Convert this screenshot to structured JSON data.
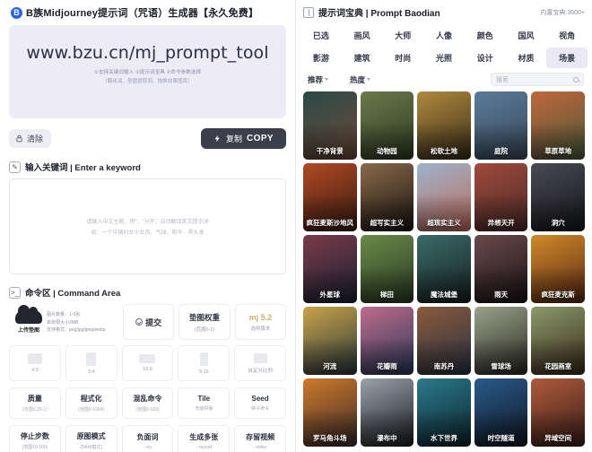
{
  "left": {
    "header": {
      "logo_letter": "B",
      "title": "B族Midjourney提示词（咒语）生成器【永久免费】"
    },
    "url_card": {
      "url": "www.bzu.cn/mj_prompt_tool",
      "sub_line_1": "①支持关键词输入 ②提示词宝典 ③命令参数选择",
      "sub_line_2": "（翻译词、垫图提取同、拖换效果图库）"
    },
    "actions": {
      "clear_label": "清除",
      "clear_icon": "lock-icon",
      "copy_cn": "复制",
      "copy_en": "COPY",
      "copy_icon": "lightning-icon"
    },
    "keyword_section": {
      "icon": "edit-note-icon",
      "label": "输入关键词 | Enter a keyword",
      "placeholder_line_1": "请输入中文主题，用\"，\"分开，自动翻译英文提示词",
      "placeholder_line_2": "如：一个中国妇女小女孩、气球、阳伞、黑头发"
    },
    "command_section": {
      "icon": "terminal-icon",
      "label": "命令区 | Command Area"
    },
    "upload": {
      "label": "上传垫图",
      "icon": "cloud-upload-icon",
      "meta": [
        "图片数量：1-5张",
        "单张限大小2MB",
        "支持格式：png/jpg/jpeg/webp"
      ]
    },
    "submit": {
      "label": "提交",
      "icon": "check-circle-icon"
    },
    "ref_weight": {
      "title": "垫图权重",
      "sub": "(范围0-2)"
    },
    "version": {
      "title": "mj 5.2",
      "sub": "选用版本"
    },
    "aspect_ratios": [
      {
        "label": "4:3",
        "w": 16,
        "h": 12
      },
      {
        "label": "3:4",
        "w": 11,
        "h": 15
      },
      {
        "label": "16:9",
        "w": 18,
        "h": 10
      },
      {
        "label": "9:16",
        "w": 9,
        "h": 15
      },
      {
        "label": "自定义比例",
        "w": 15,
        "h": 11
      }
    ],
    "params_row_1": [
      {
        "title": "质量",
        "sub": "(范围0.25-1)"
      },
      {
        "title": "程式化",
        "sub": "(范围0-1000)"
      },
      {
        "title": "混乱命令",
        "sub": "(范围0-100)"
      },
      {
        "title": "Tile",
        "sub": "无缝拼接"
      },
      {
        "title": "Seed",
        "sub": "种子命令"
      }
    ],
    "params_row_2": [
      {
        "title": "停止步数",
        "sub": "(范围10-100)"
      },
      {
        "title": "原图模式",
        "sub": "(RAW模式)"
      },
      {
        "title": "负面词",
        "sub": "--no"
      },
      {
        "title": "生成多张",
        "sub": "--repeat"
      },
      {
        "title": "存留视频",
        "sub": "--video"
      }
    ]
  },
  "right": {
    "header": {
      "icon": "book-icon",
      "title": "提示词宝典 | Prompt Baodian",
      "count": "内置宝典:3600+"
    },
    "tabs_row_1": [
      "已选",
      "画风",
      "大师",
      "人像",
      "颜色",
      "国风",
      "视角"
    ],
    "tabs_row_2": [
      "影游",
      "建筑",
      "时尚",
      "光照",
      "设计",
      "材质",
      "场景"
    ],
    "selected_tab": "场景",
    "sort": {
      "recommend": "推荐",
      "hot": "热度"
    },
    "search": {
      "placeholder": "搜索",
      "icon": "search-icon"
    },
    "cards": [
      {
        "label": "干净背景",
        "c1": "#2a4a47",
        "c2": "#6f4a3a"
      },
      {
        "label": "动物园",
        "c1": "#6a7a4a",
        "c2": "#2e3a22"
      },
      {
        "label": "松软土地",
        "c1": "#b08a3e",
        "c2": "#3a2e1a"
      },
      {
        "label": "庭院",
        "c1": "#5a7a9a",
        "c2": "#3a4a5a"
      },
      {
        "label": "草原草地",
        "c1": "#c2663a",
        "c2": "#4a5a3a"
      },
      {
        "label": "疯狂麦斯沙地风",
        "c1": "#b04a22",
        "c2": "#3a1a12"
      },
      {
        "label": "超写实主义",
        "c1": "#8a6a4a",
        "c2": "#1a1410"
      },
      {
        "label": "超现实主义",
        "c1": "#9ab4cc",
        "c2": "#c06a5a"
      },
      {
        "label": "异想天开",
        "c1": "#a04a3a",
        "c2": "#4a2a2a"
      },
      {
        "label": "洞穴",
        "c1": "#4a4a52",
        "c2": "#14161a"
      },
      {
        "label": "外星球",
        "c1": "#7a3a4a",
        "c2": "#1a2230"
      },
      {
        "label": "梯田",
        "c1": "#6a8a4a",
        "c2": "#2a3a22"
      },
      {
        "label": "魔法城堡",
        "c1": "#3a6a6a",
        "c2": "#16221f"
      },
      {
        "label": "雨天",
        "c1": "#6a4a4a",
        "c2": "#1a1216"
      },
      {
        "label": "疯狂麦克斯",
        "c1": "#d08a2a",
        "c2": "#5a2a12"
      },
      {
        "label": "河流",
        "c1": "#caa24a",
        "c2": "#2a3a3a"
      },
      {
        "label": "花瓣雨",
        "c1": "#c06a8a",
        "c2": "#2a3a5a"
      },
      {
        "label": "南苏丹",
        "c1": "#8a5a3a",
        "c2": "#2a3244"
      },
      {
        "label": "雪球场",
        "c1": "#9aa28a",
        "c2": "#2a2a22"
      },
      {
        "label": "花园画室",
        "c1": "#8a9a6a",
        "c2": "#3a2a1a"
      },
      {
        "label": "罗马角斗场",
        "c1": "#d07a2a",
        "c2": "#3a2a2a"
      },
      {
        "label": "瀑布中",
        "c1": "#9aa2aa",
        "c2": "#1a1c20"
      },
      {
        "label": "水下世界",
        "c1": "#2a7a8a",
        "c2": "#0e2430"
      },
      {
        "label": "时空隧道",
        "c1": "#2a5a8a",
        "c2": "#101824"
      },
      {
        "label": "异域空间",
        "c1": "#b05a3a",
        "c2": "#3a1e1a"
      }
    ]
  }
}
